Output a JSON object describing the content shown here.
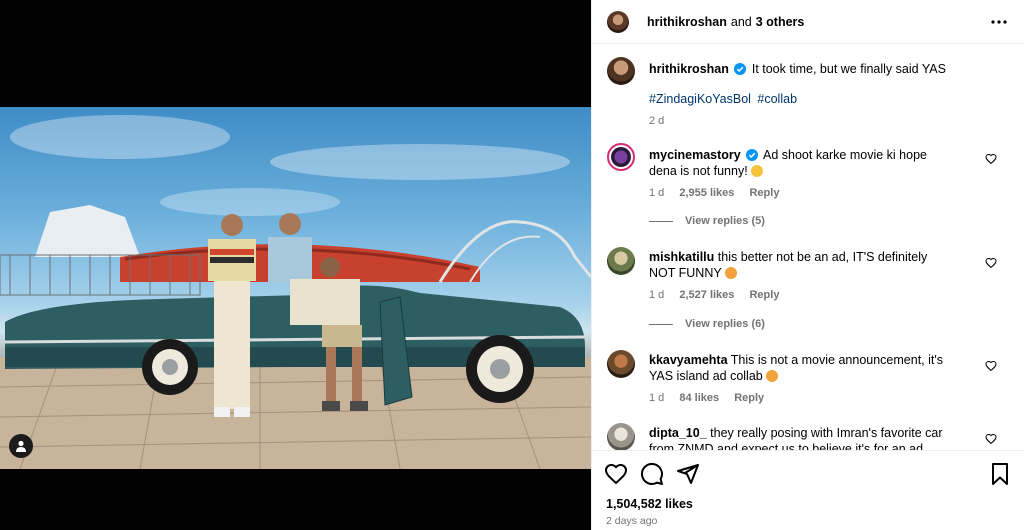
{
  "header": {
    "username": "hrithikroshan",
    "and_text": "and",
    "others_text": "3 others"
  },
  "caption": {
    "username": "hrithikroshan",
    "text": "It took time, but we finally said YAS",
    "hashtags": [
      "#ZindagiKoYasBol",
      "#collab"
    ],
    "time": "2 d"
  },
  "comments": [
    {
      "username": "mycinemastory",
      "verified": true,
      "text": "Ad shoot karke movie ki hope dena is not funny!",
      "time": "1 d",
      "likes": "2,955 likes",
      "reply": "Reply",
      "view_replies": "View replies (5)"
    },
    {
      "username": "mishkatillu",
      "verified": false,
      "text": "this better not be an ad, IT'S definitely NOT FUNNY",
      "time": "1 d",
      "likes": "2,527 likes",
      "reply": "Reply",
      "view_replies": "View replies (6)"
    },
    {
      "username": "kkavyamehta",
      "verified": false,
      "text": "This is not a movie announcement, it's YAS island ad collab",
      "time": "1 d",
      "likes": "84 likes",
      "reply": "Reply"
    },
    {
      "username": "dipta_10_",
      "verified": false,
      "text": "they really posing with Imran's favorite car from ZNMD and expect us to believe it's for an ad shootout"
    }
  ],
  "footer": {
    "likes": "1,504,582 likes",
    "time": "2 days ago"
  },
  "icons": {
    "more": "more-horizontal-icon",
    "like": "heart-icon",
    "comment": "comment-icon",
    "share": "share-icon",
    "save": "bookmark-icon",
    "tag": "user-tag-icon"
  },
  "colors": {
    "link": "#00376b",
    "muted": "#737373",
    "verified": "#0095f6"
  }
}
